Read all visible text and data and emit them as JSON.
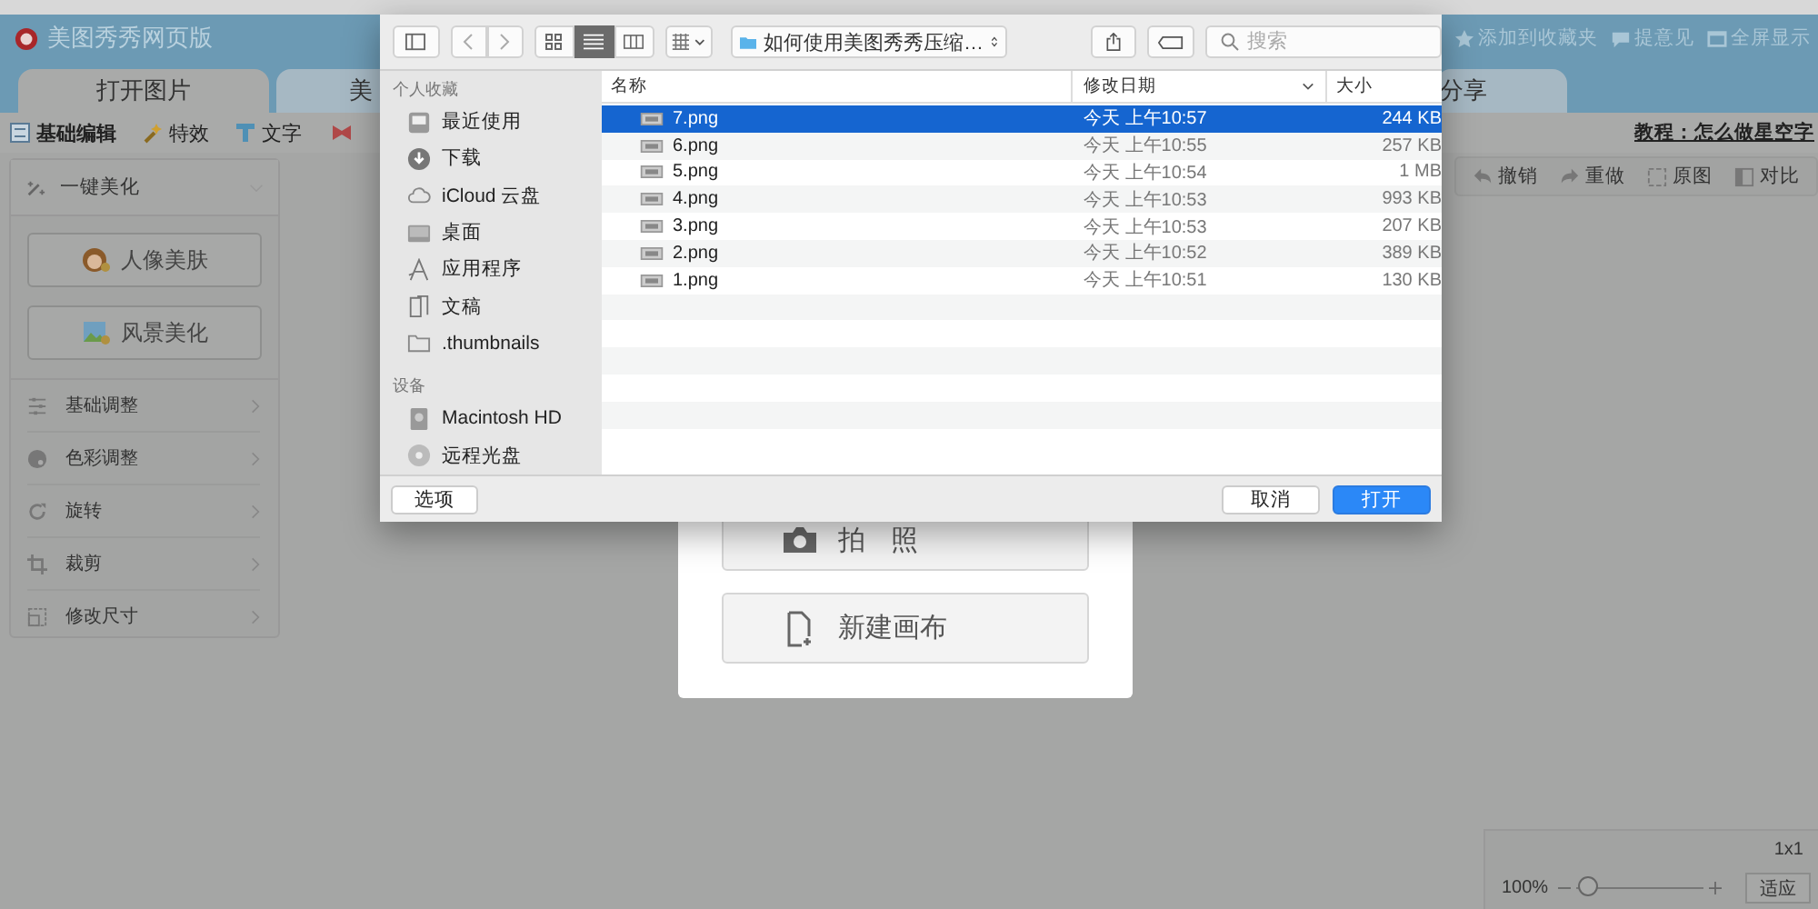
{
  "app": {
    "title": "美图秀秀网页版",
    "header_links": [
      "添加到收藏夹",
      "提意见",
      "全屏显示"
    ],
    "tabs": [
      {
        "label": "打开图片",
        "selected": true
      },
      {
        "label": "美",
        "selected": false
      },
      {
        "label": "分享",
        "selected": false
      }
    ],
    "toolbar": [
      "基础编辑",
      "特效",
      "文字"
    ],
    "tutorial_link": "教程：怎么做星空字",
    "history_buttons": [
      "撤销",
      "重做",
      "原图",
      "对比"
    ],
    "side_panel": {
      "title": "一键美化",
      "buttons": [
        "人像美肤",
        "风景美化"
      ],
      "items": [
        "基础调整",
        "色彩调整",
        "旋转",
        "裁剪",
        "修改尺寸"
      ]
    },
    "start_card": {
      "buttons": [
        "拍 照",
        "新建画布"
      ]
    },
    "zoom_panel": {
      "size": "1x1",
      "zoom": "100%",
      "level": 0.1,
      "fit_button": "适应"
    }
  },
  "dialog": {
    "path": "如何使用美图秀秀压缩…",
    "search_placeholder": "搜索",
    "favorites_heading": "个人收藏",
    "favorites": [
      "最近使用",
      "下载",
      "iCloud 云盘",
      "桌面",
      "应用程序",
      "文稿",
      ".thumbnails"
    ],
    "devices_heading": "设备",
    "devices": [
      "Macintosh HD",
      "远程光盘"
    ],
    "columns": [
      "名称",
      "修改日期",
      "大小"
    ],
    "files": [
      {
        "name": "7.png",
        "date": "今天 上午10:57",
        "size": "244 KB",
        "selected": true
      },
      {
        "name": "6.png",
        "date": "今天 上午10:55",
        "size": "257 KB",
        "selected": false
      },
      {
        "name": "5.png",
        "date": "今天 上午10:54",
        "size": "1 MB",
        "selected": false
      },
      {
        "name": "4.png",
        "date": "今天 上午10:53",
        "size": "993 KB",
        "selected": false
      },
      {
        "name": "3.png",
        "date": "今天 上午10:53",
        "size": "207 KB",
        "selected": false
      },
      {
        "name": "2.png",
        "date": "今天 上午10:52",
        "size": "389 KB",
        "selected": false
      },
      {
        "name": "1.png",
        "date": "今天 上午10:51",
        "size": "130 KB",
        "selected": false
      }
    ],
    "options_button": "选项",
    "cancel_button": "取消",
    "open_button": "打开"
  }
}
